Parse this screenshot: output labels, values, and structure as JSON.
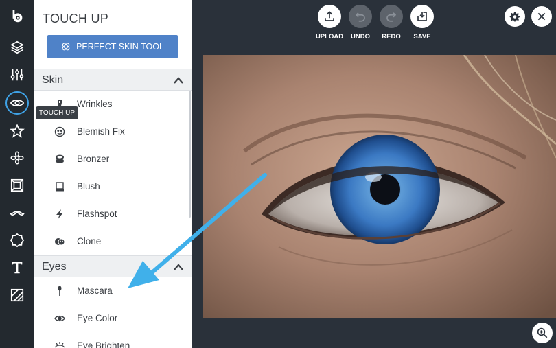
{
  "panel": {
    "title": "TOUCH UP",
    "perfect_skin_label": "PERFECT SKIN TOOL",
    "sections": {
      "skin": {
        "label": "Skin",
        "items": [
          "Wrinkles",
          "Blemish Fix",
          "Bronzer",
          "Blush",
          "Flashspot",
          "Clone"
        ]
      },
      "eyes": {
        "label": "Eyes",
        "items": [
          "Mascara",
          "Eye Color",
          "Eye Brighten"
        ]
      }
    }
  },
  "rail": {
    "tooltip": "TOUCH UP",
    "icons": [
      "logo-icon",
      "layers-icon",
      "adjust-sliders-icon",
      "eye-icon",
      "star-icon",
      "effects-icon",
      "frame-icon",
      "mustache-icon",
      "badge-icon",
      "text-icon",
      "texture-icon"
    ]
  },
  "toolbar": {
    "upload": "UPLOAD",
    "undo": "UNDO",
    "redo": "REDO",
    "save": "SAVE"
  },
  "colors": {
    "accent": "#4f82c8",
    "active_ring": "#3fa2e6",
    "arrow": "#40b0ea",
    "workspace": "#2a313a",
    "rail": "#23292f"
  }
}
